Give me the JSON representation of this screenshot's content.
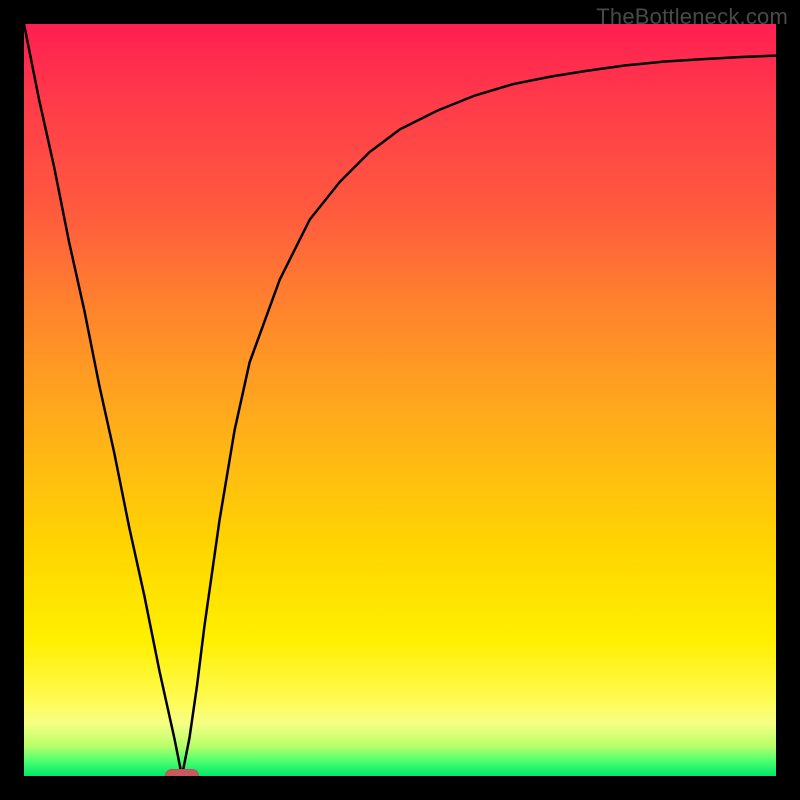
{
  "watermark": "TheBottleneck.com",
  "colors": {
    "frame": "#000000",
    "curve": "#000000",
    "marker": "#c85a5f",
    "gradient_stops": [
      "#ff1f52",
      "#ff3a4a",
      "#ff5b3e",
      "#ff8a2a",
      "#ffb218",
      "#ffd600",
      "#fff000",
      "#fffb55",
      "#f6ff85",
      "#b8ff6a",
      "#4dff6e",
      "#00e86b"
    ]
  },
  "chart_data": {
    "type": "line",
    "title": "",
    "xlabel": "",
    "ylabel": "",
    "xlim": [
      0,
      100
    ],
    "ylim": [
      0,
      100
    ],
    "grid": false,
    "legend": false,
    "series": [
      {
        "name": "curve",
        "x": [
          0,
          2,
          4,
          6,
          8,
          10,
          12,
          14,
          16,
          18,
          20,
          21,
          22,
          23,
          24,
          26,
          28,
          30,
          34,
          38,
          42,
          46,
          50,
          55,
          60,
          65,
          70,
          75,
          80,
          85,
          90,
          95,
          100
        ],
        "y": [
          100,
          90,
          81,
          71,
          62,
          52,
          43,
          33,
          24,
          14,
          5,
          0,
          5,
          12,
          20,
          34,
          46,
          55,
          66,
          74,
          79,
          83,
          86,
          88.5,
          90.5,
          92,
          93,
          93.8,
          94.5,
          95,
          95.3,
          95.6,
          95.8
        ]
      }
    ],
    "marker": {
      "x": 21,
      "y": 0
    },
    "notes": "Y expresses height from bottom as percent; no axis ticks or labels visible in source image."
  }
}
